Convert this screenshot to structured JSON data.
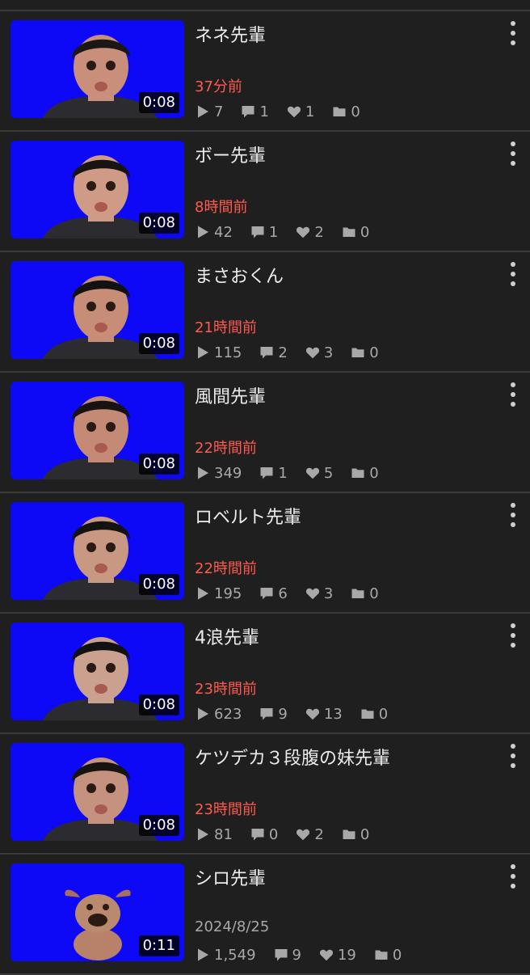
{
  "colors": {
    "background": "#1f1f1f",
    "thumb_bg": "#0d08f5",
    "recent_time": "#ff5a4e",
    "old_time": "#a8a8a8",
    "stat_text": "#a8a8a8"
  },
  "icons": {
    "play": "play-icon",
    "comment": "comment-icon",
    "like": "heart-icon",
    "folder": "folder-icon",
    "menu": "more-vertical-icon"
  },
  "videos": [
    {
      "title": "ネネ先輩",
      "time": "37分前",
      "recent": true,
      "duration": "0:08",
      "views": "7",
      "comments": "1",
      "likes": "1",
      "folders": "0"
    },
    {
      "title": "ボー先輩",
      "time": "8時間前",
      "recent": true,
      "duration": "0:08",
      "views": "42",
      "comments": "1",
      "likes": "2",
      "folders": "0"
    },
    {
      "title": "まさおくん",
      "time": "21時間前",
      "recent": true,
      "duration": "0:08",
      "views": "115",
      "comments": "2",
      "likes": "3",
      "folders": "0"
    },
    {
      "title": "風間先輩",
      "time": "22時間前",
      "recent": true,
      "duration": "0:08",
      "views": "349",
      "comments": "1",
      "likes": "5",
      "folders": "0"
    },
    {
      "title": "ロベルト先輩",
      "time": "22時間前",
      "recent": true,
      "duration": "0:08",
      "views": "195",
      "comments": "6",
      "likes": "3",
      "folders": "0"
    },
    {
      "title": "4浪先輩",
      "time": "23時間前",
      "recent": true,
      "duration": "0:08",
      "views": "623",
      "comments": "9",
      "likes": "13",
      "folders": "0"
    },
    {
      "title": "ケツデカ３段腹の妹先輩",
      "time": "23時間前",
      "recent": true,
      "duration": "0:08",
      "views": "81",
      "comments": "0",
      "likes": "2",
      "folders": "0"
    },
    {
      "title": "シロ先輩",
      "time": "2024/8/25",
      "recent": false,
      "duration": "0:11",
      "views": "1,549",
      "comments": "9",
      "likes": "19",
      "folders": "0"
    }
  ]
}
